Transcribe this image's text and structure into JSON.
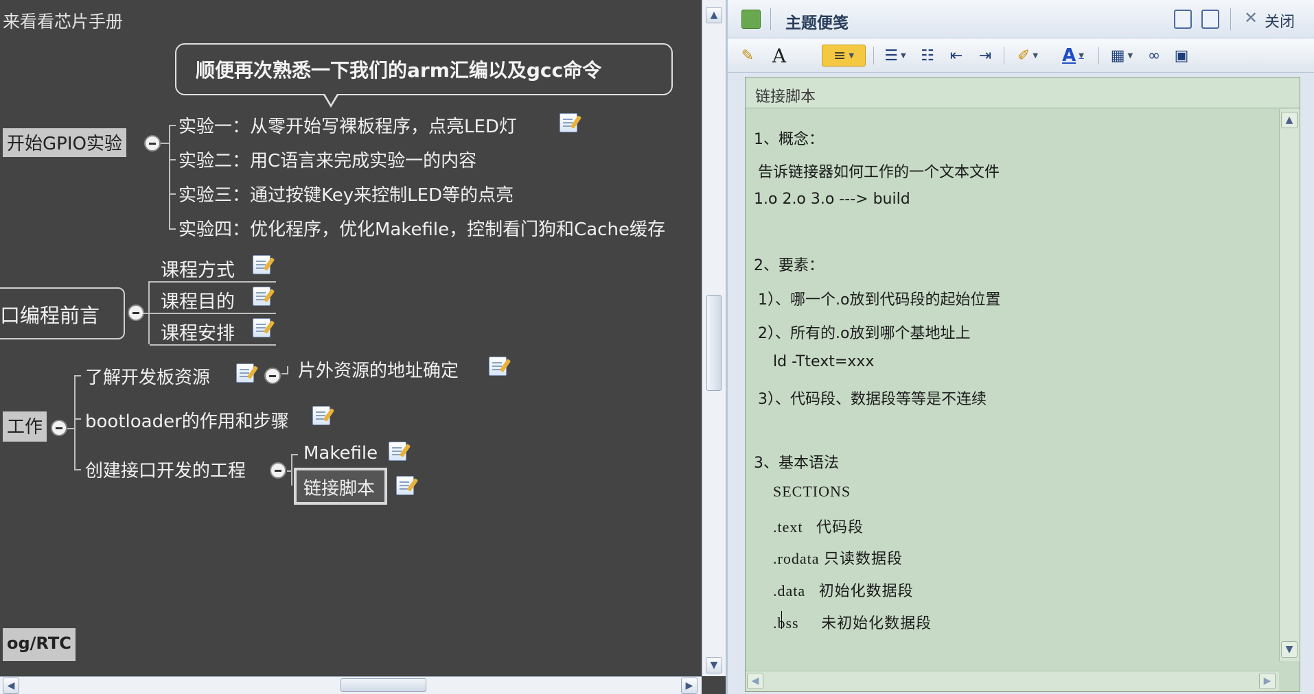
{
  "mindmap": {
    "top_partial": "来看看芯片手册",
    "callout": "顺便再次熟悉一下我们的arm汇编以及gcc命令",
    "gpio_topic": "开始GPIO实验",
    "gpio_children": [
      "实验一：从零开始写裸板程序，点亮LED灯",
      "实验二：用C语言来完成实验一的内容",
      "实验三：通过按键Key来控制LED等的点亮",
      "实验四：优化程序，优化Makefile，控制看门狗和Cache缓存"
    ],
    "preface_topic": "口编程前言",
    "preface_children": [
      "课程方式",
      "课程目的",
      "课程安排"
    ],
    "work_topic": "工作",
    "work_children": [
      "了解开发板资源",
      "bootloader的作用和步骤",
      "创建接口开发的工程"
    ],
    "resource_child": "片外资源的地址确定",
    "project_children": [
      "Makefile",
      "链接脚本"
    ],
    "rtc_topic": "og/RTC"
  },
  "notes_panel": {
    "title": "主题便笺",
    "close_label": "关闭",
    "toolbar_icons": [
      "brush-icon",
      "font-icon",
      "align-left-icon",
      "numbered-list-icon",
      "bullet-list-icon",
      "outdent-icon",
      "indent-icon",
      "highlight-icon",
      "font-color-icon",
      "table-icon",
      "link-icon",
      "image-icon"
    ],
    "accent_color": "#f5c842",
    "editor": {
      "heading": "链接脚本",
      "lines": [
        "1、概念：",
        "告诉链接器如何工作的一个文本文件",
        "1.o 2.o 3.o ---> build",
        "2、要素：",
        "1）、哪一个.o放到代码段的起始位置",
        "2）、所有的.o放到哪个基地址上",
        "ld -Ttext=xxx",
        "3）、代码段、数据段等等是不连续",
        "3、基本语法",
        "SECTIONS",
        ".text   代码段",
        ".rodata 只读数据段",
        ".data   初始化数据段",
        ".bss     未初始化数据段"
      ]
    }
  }
}
